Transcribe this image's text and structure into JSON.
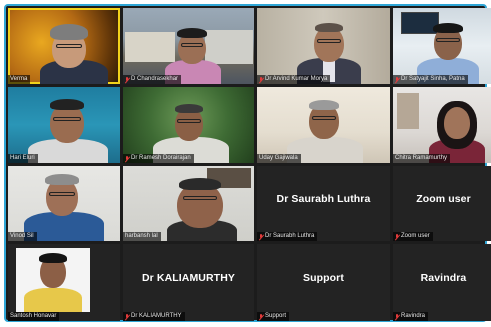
{
  "participants": [
    {
      "name": "Verma",
      "speaking": true
    },
    {
      "name": "D Chandrasekhar",
      "mic_muted": true
    },
    {
      "name": "Dr Arvind Kumar Morya",
      "mic_muted": true
    },
    {
      "name": "Dr Satyajit Sinha, Patna",
      "mic_muted": true
    },
    {
      "name": "Hari Eluri"
    },
    {
      "name": "Dr Ramesh Dorairajan",
      "mic_muted": true
    },
    {
      "name": "Uday Gajiwala"
    },
    {
      "name": "Chitra Ramamurthy"
    },
    {
      "name": "Vinod Sil"
    },
    {
      "name": "harbansh lal"
    },
    {
      "name": "Dr Saurabh Luthra",
      "display": "Dr Saurabh Luthra",
      "mic_muted": true,
      "video_off": true
    },
    {
      "name": "Zoom user",
      "display": "Zoom user",
      "mic_muted": true,
      "video_off": true
    },
    {
      "name": "Santosh Honavar"
    },
    {
      "name": "Dr KALIAMURTHY",
      "display": "Dr KALIAMURTHY",
      "mic_muted": true,
      "video_off": true
    },
    {
      "name": "Support",
      "display": "Support",
      "mic_muted": true,
      "video_off": true
    },
    {
      "name": "Ravindra",
      "display": "Ravindra",
      "mic_muted": true,
      "video_off": true
    }
  ],
  "labels": {
    "t0": "Verma",
    "t1": "D Chandrasekhar",
    "t2": "Dr Arvind Kumar Morya",
    "t3": "Dr Satyajit Sinha, Patna",
    "t4": "Hari Eluri",
    "t5": "Dr Ramesh Dorairajan",
    "t6": "Uday Gajiwala",
    "t7": "Chitra Ramamurthy",
    "t8": "Vinod Sil",
    "t9": "harbansh lal",
    "t10": "Dr Saurabh Luthra",
    "t11": "Zoom user",
    "t12": "Santosh Honavar",
    "t13": "Dr KALIAMURTHY",
    "t14": "Support",
    "t15": "Ravindra"
  },
  "colors": {
    "frame_border": "#2fa6d6",
    "active_speaker": "#f2d21b",
    "mic_muted": "#e23b3b",
    "tile_bg": "#232323"
  }
}
